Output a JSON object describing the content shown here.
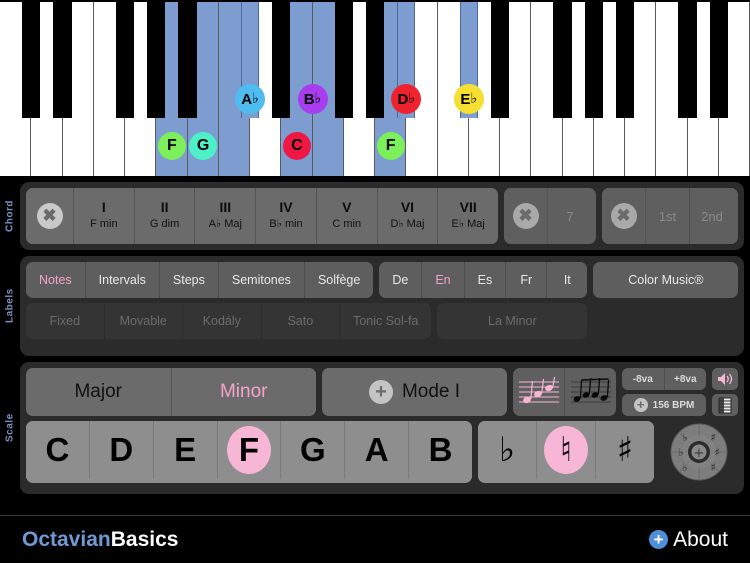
{
  "piano": {
    "white_keys": [
      {
        "i": 0,
        "name": "",
        "hl": false
      },
      {
        "i": 1,
        "name": "",
        "hl": false
      },
      {
        "i": 2,
        "name": "",
        "hl": false
      },
      {
        "i": 3,
        "name": "",
        "hl": false
      },
      {
        "i": 4,
        "name": "",
        "hl": false
      },
      {
        "i": 5,
        "name": "F",
        "hl": true
      },
      {
        "i": 6,
        "name": "G",
        "hl": true
      },
      {
        "i": 7,
        "name": "",
        "hl": true
      },
      {
        "i": 8,
        "name": "",
        "hl": false
      },
      {
        "i": 9,
        "name": "C",
        "hl": true
      },
      {
        "i": 10,
        "name": "",
        "hl": true
      },
      {
        "i": 11,
        "name": "",
        "hl": false
      },
      {
        "i": 12,
        "name": "F",
        "hl": true
      },
      {
        "i": 13,
        "name": "",
        "hl": false
      },
      {
        "i": 14,
        "name": "",
        "hl": false
      },
      {
        "i": 15,
        "name": "",
        "hl": false
      },
      {
        "i": 16,
        "name": "",
        "hl": false
      },
      {
        "i": 17,
        "name": "",
        "hl": false
      },
      {
        "i": 18,
        "name": "",
        "hl": false
      },
      {
        "i": 19,
        "name": "",
        "hl": false
      },
      {
        "i": 20,
        "name": "",
        "hl": false
      },
      {
        "i": 21,
        "name": "",
        "hl": false
      },
      {
        "i": 22,
        "name": "",
        "hl": false
      },
      {
        "i": 23,
        "name": "",
        "hl": false
      }
    ],
    "marked_notes": [
      {
        "label": "F",
        "accidental": "",
        "color": "#7cf05a",
        "type": "white",
        "key": 5
      },
      {
        "label": "G",
        "accidental": "",
        "color": "#4ef0c8",
        "type": "white",
        "key": 6
      },
      {
        "label": "C",
        "accidental": "",
        "color": "#ef1845",
        "type": "white",
        "key": 9
      },
      {
        "label": "F",
        "accidental": "",
        "color": "#7cf05a",
        "type": "white",
        "key": 12
      },
      {
        "label": "A",
        "accidental": "♭",
        "color": "#4fbcf0",
        "type": "black"
      },
      {
        "label": "B",
        "accidental": "♭",
        "color": "#a83df0",
        "type": "black"
      },
      {
        "label": "D",
        "accidental": "♭",
        "color": "#ef2330",
        "type": "black"
      },
      {
        "label": "E",
        "accidental": "♭",
        "color": "#f5e032",
        "type": "black"
      }
    ]
  },
  "chord": {
    "side_label": "Chord",
    "clear_icon": "close-icon",
    "degrees": [
      {
        "numeral": "I",
        "name": "F min"
      },
      {
        "numeral": "II",
        "name": "G dim"
      },
      {
        "numeral": "III",
        "name": "A♭ Maj"
      },
      {
        "numeral": "IV",
        "name": "B♭ min"
      },
      {
        "numeral": "V",
        "name": "C min"
      },
      {
        "numeral": "VI",
        "name": "D♭ Maj"
      },
      {
        "numeral": "VII",
        "name": "E♭ Maj"
      }
    ],
    "seventh_label": "7",
    "inversions": [
      "1st",
      "2nd"
    ]
  },
  "labels": {
    "side_label": "Labels",
    "naming": [
      {
        "label": "Notes",
        "active": true
      },
      {
        "label": "Intervals",
        "active": false
      },
      {
        "label": "Steps",
        "active": false
      },
      {
        "label": "Semitones",
        "active": false
      },
      {
        "label": "Solfège",
        "active": false
      }
    ],
    "languages": [
      {
        "label": "De",
        "active": false
      },
      {
        "label": "En",
        "active": true
      },
      {
        "label": "Es",
        "active": false
      },
      {
        "label": "Fr",
        "active": false
      },
      {
        "label": "It",
        "active": false
      }
    ],
    "color_music": "Color Music®",
    "solfege_systems": [
      "Fixed",
      "Movable",
      "Kodály",
      "Sato",
      "Tonic Sol-fa"
    ],
    "minor_mode": "La Minor"
  },
  "scale": {
    "side_label": "Scale",
    "quality": [
      {
        "label": "Major",
        "active": false
      },
      {
        "label": "Minor",
        "active": true
      }
    ],
    "mode_label": "Mode I",
    "staff_icons": [
      "staff-ascending-icon",
      "staff-notes-icon"
    ],
    "octave_down": "-8va",
    "octave_up": "+8va",
    "tempo": "156 BPM",
    "speaker_icon": "speaker-icon",
    "keyboard_icon": "keyboard-icon",
    "notes": [
      {
        "label": "C",
        "selected": false
      },
      {
        "label": "D",
        "selected": false
      },
      {
        "label": "E",
        "selected": false
      },
      {
        "label": "F",
        "selected": true
      },
      {
        "label": "G",
        "selected": false
      },
      {
        "label": "A",
        "selected": false
      },
      {
        "label": "B",
        "selected": false
      }
    ],
    "accidentals": [
      {
        "label": "♭",
        "selected": false,
        "name": "flat"
      },
      {
        "label": "♮",
        "selected": true,
        "name": "natural"
      },
      {
        "label": "♯",
        "selected": false,
        "name": "sharp"
      }
    ],
    "wheel_icon": "key-signature-wheel-icon"
  },
  "footer": {
    "brand_part1": "Octavian",
    "brand_part2": "Basics",
    "about_label": "About",
    "about_icon": "plus-circle-icon"
  },
  "colors": {
    "accent_pink": "#f5a3c8",
    "highlight_blue": "#7d9dd0",
    "brand_blue": "#6f9ad6"
  }
}
